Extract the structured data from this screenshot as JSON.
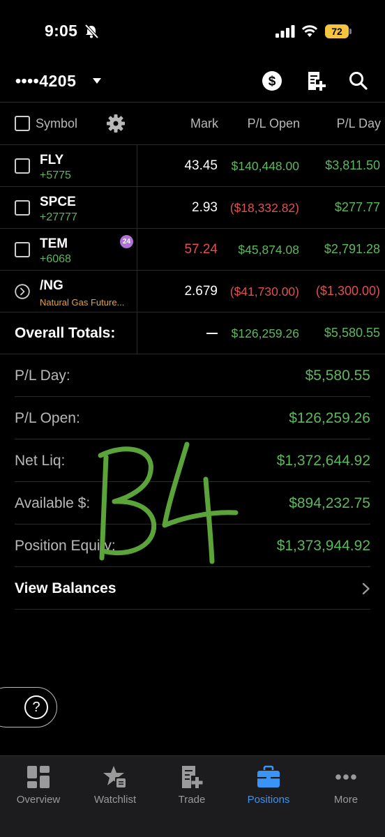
{
  "status_bar": {
    "time": "9:05",
    "battery": "72"
  },
  "header": {
    "account": "••••4205"
  },
  "columns": {
    "symbol": "Symbol",
    "mark": "Mark",
    "pl_open": "P/L Open",
    "pl_day": "P/L Day"
  },
  "positions": [
    {
      "symbol": "FLY",
      "sub": "+5775",
      "mark": "43.45",
      "pl_open": "$140,448.00",
      "pl_day": "$3,811.50"
    },
    {
      "symbol": "SPCE",
      "sub": "+27777",
      "mark": "2.93",
      "pl_open": "($18,332.82)",
      "pl_day": "$277.77"
    },
    {
      "symbol": "TEM",
      "sub": "+6068",
      "badge": "24",
      "mark": "57.24",
      "pl_open": "$45,874.08",
      "pl_day": "$2,791.28"
    },
    {
      "symbol": "/NG",
      "sub": "Natural Gas Future...",
      "mark": "2.679",
      "pl_open": "($41,730.00)",
      "pl_day": "($1,300.00)"
    }
  ],
  "totals": {
    "label": "Overall Totals:",
    "pl_open": "$126,259.26",
    "pl_day": "$5,580.55"
  },
  "summary": [
    {
      "label": "P/L Day:",
      "value": "$5,580.55"
    },
    {
      "label": "P/L Open:",
      "value": "$126,259.26"
    },
    {
      "label": "Net Liq:",
      "value": "$1,372,644.92"
    },
    {
      "label": "Available $:",
      "value": "$894,232.75"
    },
    {
      "label": "Position Equity:",
      "value": "$1,373,944.92"
    }
  ],
  "view_balances": "View Balances",
  "handwriting": "B4",
  "help": "?",
  "tabs": [
    {
      "label": "Overview"
    },
    {
      "label": "Watchlist"
    },
    {
      "label": "Trade"
    },
    {
      "label": "Positions"
    },
    {
      "label": "More"
    }
  ],
  "colors": {
    "positive": "#5cb85c",
    "negative": "#e05050",
    "active_tab": "#3a94f5",
    "handwriting": "#5aa43a",
    "badge": "#b072d4",
    "future_sub": "#e8a33a"
  }
}
